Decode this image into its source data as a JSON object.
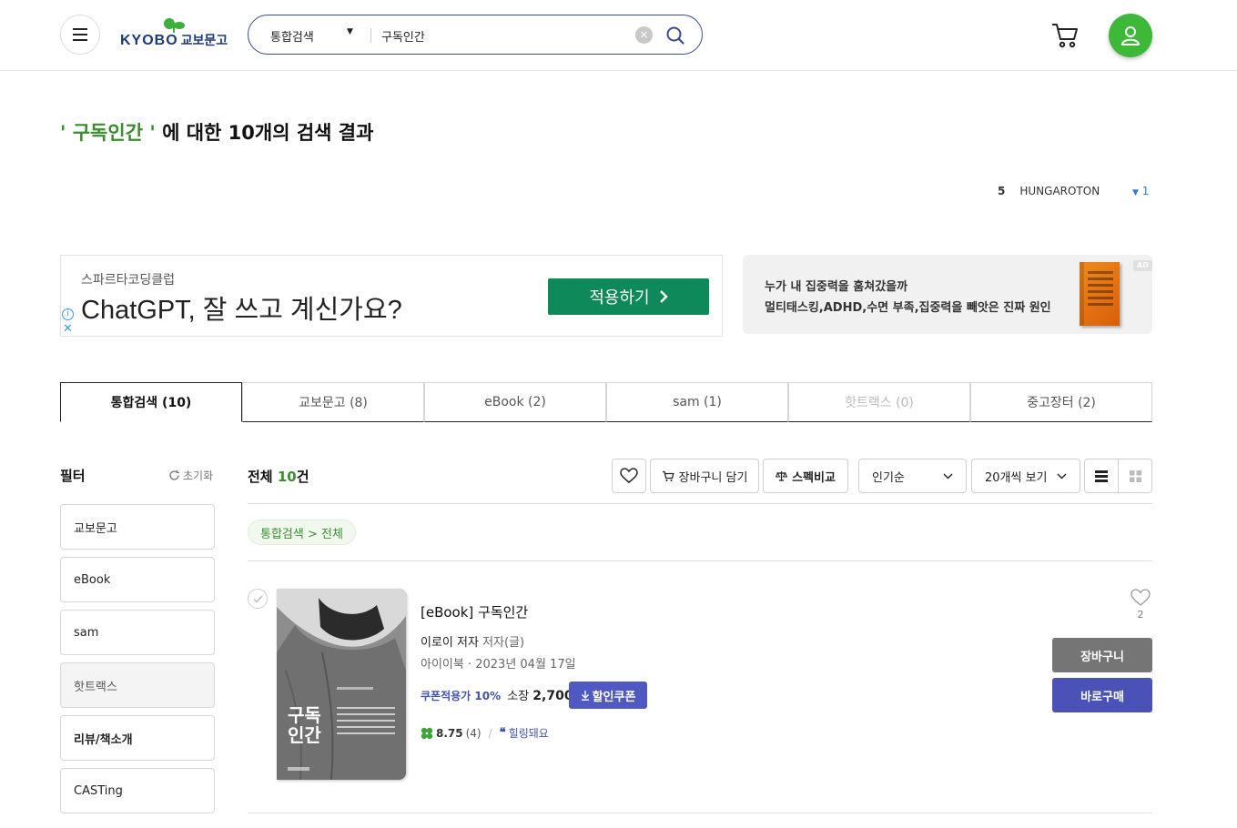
{
  "header": {
    "logo_text": "KYOBO",
    "logo_text_kr": "교보문고",
    "search": {
      "category": "통합검색",
      "query": "구독인간"
    },
    "icons": [
      "menu-icon",
      "search-icon",
      "clear-icon",
      "cart-icon",
      "user-icon"
    ]
  },
  "results": {
    "keyword": "' 구독인간 '",
    "title_suffix": " 에 대한 10개의 검색 결과"
  },
  "ranking": {
    "number": "5",
    "keyword": "HUNGAROTON",
    "change": "1",
    "change_direction": "down"
  },
  "ads": {
    "left": {
      "brand": "스파르타코딩클럽",
      "headline": "ChatGPT, 잘 쓰고 계신가요?",
      "cta": "적용하기"
    },
    "right": {
      "line1": "누가 내 집중력을 훔쳐갔을까",
      "line2": "멀티태스킹,ADHD,수면 부족,집중력을 빼앗은 진짜 원인",
      "tag": "AD"
    }
  },
  "tabs": [
    {
      "label": "통합검색 (10)",
      "state": "active"
    },
    {
      "label": "교보문고 (8)",
      "state": "normal"
    },
    {
      "label": "eBook (2)",
      "state": "normal"
    },
    {
      "label": "sam (1)",
      "state": "normal"
    },
    {
      "label": "핫트랙스 (0)",
      "state": "disabled"
    },
    {
      "label": "중고장터 (2)",
      "state": "normal"
    }
  ],
  "filter": {
    "title": "필터",
    "reset": "초기화",
    "items": [
      {
        "label": "교보문고"
      },
      {
        "label": "eBook"
      },
      {
        "label": "sam"
      },
      {
        "label": "핫트랙스"
      },
      {
        "label": "리뷰/책소개"
      },
      {
        "label": "CASTing"
      }
    ]
  },
  "toolbar": {
    "total_prefix": "전체 ",
    "total_count": "10",
    "total_suffix": "건",
    "add_cart": "장바구니 담기",
    "compare": "스펙비교",
    "sort": "인기순",
    "per_page": "20개씩 보기"
  },
  "breadcrumb": "통합검색 > 전체",
  "product": {
    "title": "[eBook]  구독인간",
    "author": "이로이 저자",
    "author_role": " 저자(글)",
    "publisher": "아이이북 · 2023년 04월 17일",
    "coupon_rate": "쿠폰적용가 10%",
    "price_label": " 소장 ",
    "price": "2,700원",
    "coupon_btn": "할인쿠폰",
    "rating": "8.75",
    "rating_count": "(4)",
    "review_tag": "힐링돼요",
    "wish_count": "2",
    "cart_btn": "장바구니",
    "buy_btn": "바로구매",
    "cover_title_line1": "구독",
    "cover_title_line2": "인간"
  }
}
